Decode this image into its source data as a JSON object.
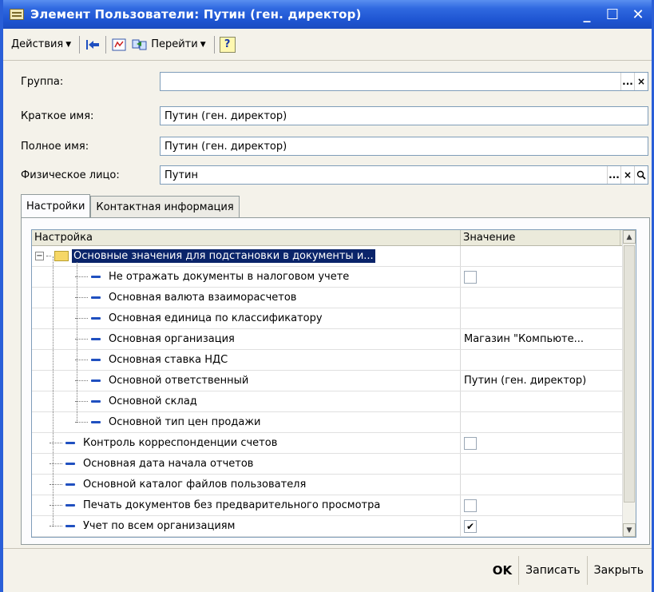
{
  "window": {
    "title": "Элемент Пользователи: Путин (ген. директор)",
    "controls": {
      "minimize": "_",
      "maximize": "☐",
      "close": "✕"
    }
  },
  "toolbar": {
    "actions_label": "Действия",
    "goto_label": "Перейти",
    "help_label": "?"
  },
  "form": {
    "group": {
      "label": "Группа:",
      "value": ""
    },
    "short_name": {
      "label": "Краткое имя:",
      "value": "Путин (ген. директор)"
    },
    "full_name": {
      "label": "Полное имя:",
      "value": "Путин (ген. директор)"
    },
    "person": {
      "label": "Физическое лицо:",
      "value": "Путин"
    },
    "select_btn": "...",
    "clear_btn": "×",
    "search_icon": "magnifier-icon"
  },
  "tabs": [
    {
      "label": "Настройки",
      "active": true
    },
    {
      "label": "Контактная информация",
      "active": false
    }
  ],
  "grid": {
    "headers": {
      "setting": "Настройка",
      "value": "Значение"
    },
    "rows": [
      {
        "level": 0,
        "type": "folder",
        "label": "Основные значения для подстановки в документы и...",
        "value": "",
        "checkbox": null,
        "selected": true
      },
      {
        "level": 1,
        "type": "item",
        "label": "Не отражать документы в налоговом учете",
        "value": "",
        "checkbox": false
      },
      {
        "level": 1,
        "type": "item",
        "label": "Основная валюта взаиморасчетов",
        "value": "",
        "checkbox": null
      },
      {
        "level": 1,
        "type": "item",
        "label": "Основная единица по классификатору",
        "value": "",
        "checkbox": null
      },
      {
        "level": 1,
        "type": "item",
        "label": "Основная организация",
        "value": "Магазин \"Компьюте...",
        "checkbox": null
      },
      {
        "level": 1,
        "type": "item",
        "label": "Основная ставка НДС",
        "value": "",
        "checkbox": null
      },
      {
        "level": 1,
        "type": "item",
        "label": "Основной ответственный",
        "value": "Путин (ген. директор)",
        "checkbox": null
      },
      {
        "level": 1,
        "type": "item",
        "label": "Основной склад",
        "value": "",
        "checkbox": null
      },
      {
        "level": 1,
        "type": "item",
        "label": "Основной тип цен продажи",
        "value": "",
        "checkbox": null
      },
      {
        "level": 0,
        "type": "item",
        "label": "Контроль корреспонденции счетов",
        "value": "",
        "checkbox": false
      },
      {
        "level": 0,
        "type": "item",
        "label": "Основная дата начала отчетов",
        "value": "",
        "checkbox": null
      },
      {
        "level": 0,
        "type": "item",
        "label": "Основной каталог файлов пользователя",
        "value": "",
        "checkbox": null
      },
      {
        "level": 0,
        "type": "item",
        "label": "Печать документов без предварительного просмотра",
        "value": "",
        "checkbox": false
      },
      {
        "level": 0,
        "type": "item",
        "label": "Учет по всем организациям",
        "value": "",
        "checkbox": true
      }
    ]
  },
  "footer": {
    "ok_label": "OK",
    "save_label": "Записать",
    "close_label": "Закрыть"
  }
}
